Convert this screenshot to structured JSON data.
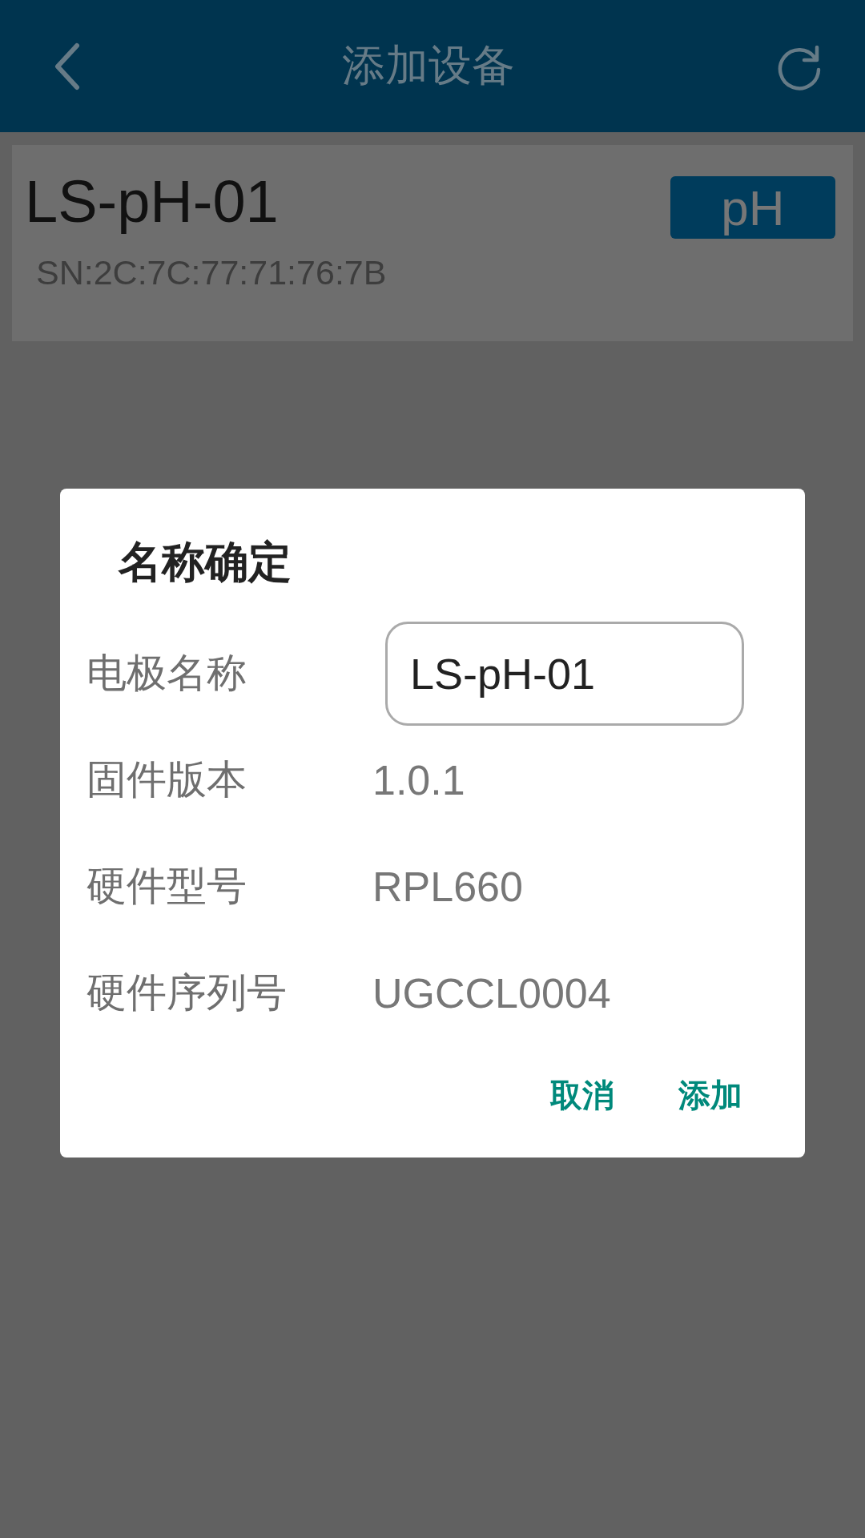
{
  "header": {
    "title": "添加设备"
  },
  "device": {
    "name": "LS-pH-01",
    "serial": "SN:2C:7C:77:71:76:7B",
    "badge": "pH"
  },
  "dialog": {
    "title": "名称确定",
    "fields": [
      {
        "kind": "input",
        "label": "电极名称",
        "value": "LS-pH-01"
      },
      {
        "kind": "text",
        "label": "固件版本",
        "value": "1.0.1"
      },
      {
        "kind": "text",
        "label": "硬件型号",
        "value": "RPL660"
      },
      {
        "kind": "text",
        "label": "硬件序列号",
        "value": "UGCCL0004"
      }
    ],
    "buttons": [
      "取消",
      "添加"
    ]
  }
}
